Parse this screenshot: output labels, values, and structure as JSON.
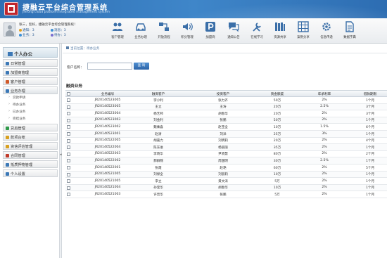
{
  "app": {
    "title": "捷融云平台综合管理系统",
    "subtitle": "Jierong cloud platform integrated management system"
  },
  "user": {
    "greeting": "张三，您好，捷融云平台综合管理系统！",
    "stats": [
      {
        "label": "通知：3",
        "color": "#e0a020"
      },
      {
        "label": "消息：3",
        "color": "#3b8fd6"
      },
      {
        "label": "业务：3",
        "color": "#3b8fd6"
      },
      {
        "label": "待办：3",
        "color": "#7a6fd0"
      }
    ]
  },
  "nav": [
    {
      "label": "客户管理",
      "icon": "users-icon"
    },
    {
      "label": "业务办理",
      "icon": "car-icon"
    },
    {
      "label": "开放流程",
      "icon": "flow-icon"
    },
    {
      "label": "积分管理",
      "icon": "speaker-icon"
    },
    {
      "label": "加盟商",
      "icon": "p-icon"
    },
    {
      "label": "通知公告",
      "icon": "chat-icon"
    },
    {
      "label": "在线学习",
      "icon": "tools-icon"
    },
    {
      "label": "资源共享",
      "icon": "books-icon"
    },
    {
      "label": "案例分享",
      "icon": "grid-icon"
    },
    {
      "label": "信息传递",
      "icon": "gear-icon"
    },
    {
      "label": "数据字典",
      "icon": "document-icon"
    }
  ],
  "sidebar": {
    "header": "个人办公",
    "items": [
      {
        "label": "日常管理",
        "color": "#3b78b6"
      },
      {
        "label": "加盟商管理",
        "color": "#3b78b6"
      },
      {
        "label": "客户管理",
        "color": "#d05a2a"
      },
      {
        "label": "业务办理",
        "color": "#3b78b6"
      }
    ],
    "subitems": [
      "贷款申请",
      "待办业务",
      "已办业务",
      "完结业务"
    ],
    "items2": [
      {
        "label": "贷后管理",
        "color": "#2f9a4a"
      },
      {
        "label": "款项台帐",
        "color": "#d8a020"
      },
      {
        "label": "资信评估管理",
        "color": "#d8a020"
      },
      {
        "label": "合同管理",
        "color": "#c03a2a"
      },
      {
        "label": "抵质押物管理",
        "color": "#3b78b6"
      },
      {
        "label": "个人设置",
        "color": "#3b78b6"
      }
    ]
  },
  "breadcrumb": "当前位置：待办业务",
  "search": {
    "label": "客户名称：",
    "button": "查 询",
    "value": ""
  },
  "section_title": "融资业务",
  "table": {
    "headers": [
      "业务编号",
      "融资客户",
      "投资客户",
      "资金额度",
      "年承利率",
      "借款期限"
    ],
    "rows": [
      [
        "JR20140523005",
        "李小利",
        "张力齐",
        "50万",
        "2%",
        "1个月"
      ],
      [
        "JR20140523005",
        "王立",
        "王涛",
        "20万",
        "2.5%",
        "3个月"
      ],
      [
        "JR20140523004",
        "杨艺邦",
        "胡春华",
        "20万",
        "2%",
        "3个月"
      ],
      [
        "JR20140523003",
        "刘金利",
        "张鹏",
        "50万",
        "2%",
        "1个月"
      ],
      [
        "JR20140523002",
        "魏乘喜",
        "赵宝全",
        "10万",
        "1.5%",
        "6个月"
      ],
      [
        "JR20140523001",
        "赵清",
        "刘洋",
        "25万",
        "3%",
        "1个月"
      ],
      [
        "JR20140522005",
        "胡嘉力",
        "刘明莉",
        "20万",
        "2%",
        "4个月"
      ],
      [
        "JR20140522004",
        "陈东进",
        "杨丽丽",
        "35万",
        "2%",
        "1个月"
      ],
      [
        "JR20140522003",
        "李晓华",
        "尹晓慧",
        "80万",
        "2%",
        "2个月"
      ],
      [
        "JR20140522002",
        "郝群锦",
        "周国明",
        "30万",
        "2.5%",
        "1个月"
      ],
      [
        "JR20140522001",
        "张霞",
        "赵艳",
        "60万",
        "2%",
        "5个月"
      ],
      [
        "JR20140521005",
        "刘保全",
        "刘丽莉",
        "10万",
        "2%",
        "1个月"
      ],
      [
        "JR20140521005",
        "李立",
        "黄文涛",
        "5万",
        "2%",
        "1个月"
      ],
      [
        "JR20140521004",
        "孙宝华",
        "胡春华",
        "10万",
        "2%",
        "1个月"
      ],
      [
        "JR20140521003",
        "许晋华",
        "张鹏",
        "5万",
        "2%",
        "1个月"
      ]
    ]
  }
}
